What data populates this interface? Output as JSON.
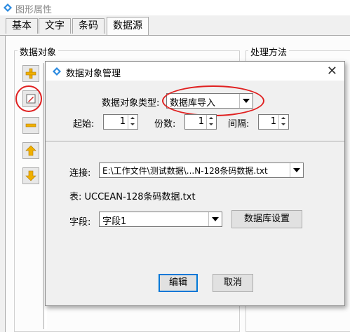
{
  "window": {
    "title": "图形属性"
  },
  "tabs": [
    {
      "label": "基本"
    },
    {
      "label": "文字"
    },
    {
      "label": "条码"
    },
    {
      "label": "数据源"
    }
  ],
  "left_group": {
    "label": "数据对象"
  },
  "right_group": {
    "label": "处理方法"
  },
  "dialog": {
    "title": "数据对象管理",
    "type_label": "数据对象类型:",
    "type_value": "数据库导入",
    "start_label": "起始:",
    "start_value": "1",
    "copies_label": "份数:",
    "copies_value": "1",
    "interval_label": "间隔:",
    "interval_value": "1",
    "connect_label": "连接:",
    "connect_value": "E:\\工作文件\\测试数据\\...N-128条码数据.txt",
    "table_text": "表: UCCEAN-128条码数据.txt",
    "field_label": "字段:",
    "field_value": "字段1",
    "db_settings_button": "数据库设置",
    "edit_button": "编辑",
    "cancel_button": "取消"
  },
  "colors": {
    "accent": "#0078d7",
    "highlight_ellipse": "#e02020"
  }
}
